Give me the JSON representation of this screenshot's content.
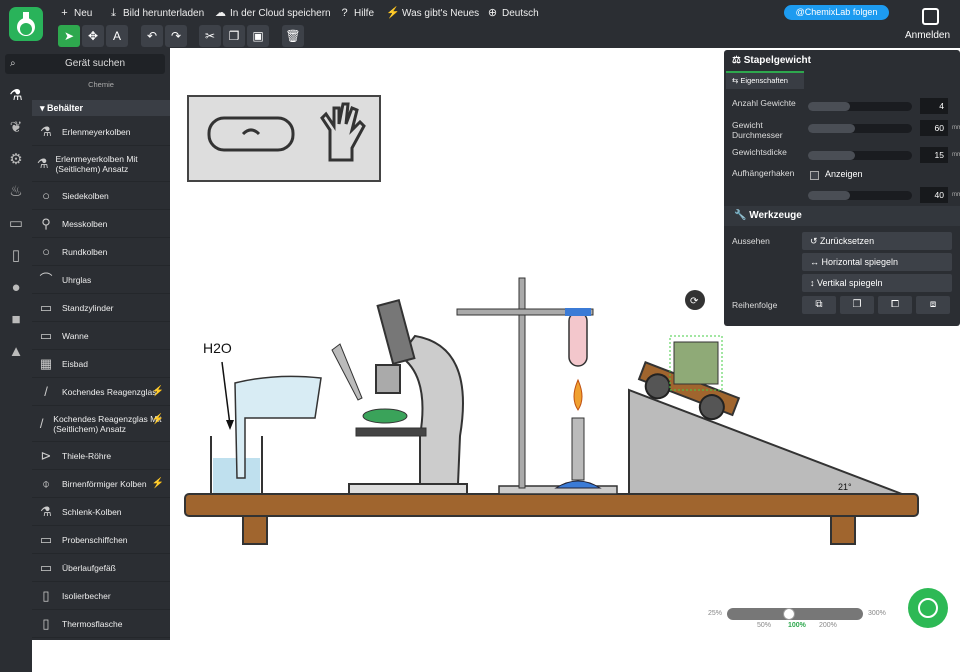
{
  "header": {
    "menu": [
      {
        "icon": "plus-icon",
        "label": "Neu"
      },
      {
        "icon": "download-icon",
        "label": "Bild herunterladen"
      },
      {
        "icon": "cloud-icon",
        "label": "In der Cloud speichern"
      },
      {
        "icon": "help-icon",
        "label": "Hilfe"
      },
      {
        "icon": "bolt-icon",
        "label": "Was gibt's Neues"
      },
      {
        "icon": "globe-icon",
        "label": "Deutsch"
      }
    ],
    "follow_label": "@ChemixLab folgen",
    "login_label": "Anmelden"
  },
  "toolbar": {
    "tools": [
      "select-tool",
      "move-tool",
      "text-tool",
      "undo",
      "redo",
      "cut",
      "copy",
      "paste",
      "delete"
    ]
  },
  "sidebar": {
    "search_placeholder": "Gerät suchen",
    "category": "Chemie",
    "group": "Behälter",
    "items": [
      {
        "label": "Erlenmeyerkolben",
        "bolt": false
      },
      {
        "label": "Erlenmeyerkolben Mit (Seitlichem) Ansatz",
        "bolt": false
      },
      {
        "label": "Siedekolben",
        "bolt": false
      },
      {
        "label": "Messkolben",
        "bolt": false
      },
      {
        "label": "Rundkolben",
        "bolt": false
      },
      {
        "label": "Uhrglas",
        "bolt": false
      },
      {
        "label": "Standzylinder",
        "bolt": false
      },
      {
        "label": "Wanne",
        "bolt": false
      },
      {
        "label": "Eisbad",
        "bolt": false
      },
      {
        "label": "Kochendes Reagenzglas",
        "bolt": true
      },
      {
        "label": "Kochendes Reagenzglas Mit (Seitlichem) Ansatz",
        "bolt": true
      },
      {
        "label": "Thiele-Röhre",
        "bolt": false
      },
      {
        "label": "Birnenförmiger Kolben",
        "bolt": true
      },
      {
        "label": "Schlenk-Kolben",
        "bolt": false
      },
      {
        "label": "Probenschiffchen",
        "bolt": false
      },
      {
        "label": "Überlaufgefäß",
        "bolt": false
      },
      {
        "label": "Isolierbecher",
        "bolt": false
      },
      {
        "label": "Thermosflasche",
        "bolt": false
      }
    ]
  },
  "panel": {
    "title": "Stapelgewicht",
    "tab": "Eigenschaften",
    "props": [
      {
        "label": "Anzahl Gewichte",
        "value": "4",
        "unit": "",
        "fill": 0.4
      },
      {
        "label": "Gewicht Durchmesser",
        "value": "60",
        "unit": "mm",
        "fill": 0.45
      },
      {
        "label": "Gewichtsdicke",
        "value": "15",
        "unit": "mm",
        "fill": 0.45
      },
      {
        "label": "Aufhängerhaken",
        "checkbox": "Anzeigen"
      },
      {
        "label": "",
        "value": "40",
        "unit": "mm",
        "fill": 0.4
      }
    ],
    "tools_title": "Werkzeuge",
    "look_label": "Aussehen",
    "buttons": [
      "Zurücksetzen",
      "Horizontal spiegeln",
      "Vertikal spiegeln"
    ],
    "order_label": "Reihenfolge"
  },
  "canvas": {
    "h2o_label": "H2O",
    "angle_label": "21°"
  },
  "zoom": {
    "min": "25%",
    "max": "300%",
    "marks": [
      "50%",
      "100%",
      "200%"
    ]
  }
}
